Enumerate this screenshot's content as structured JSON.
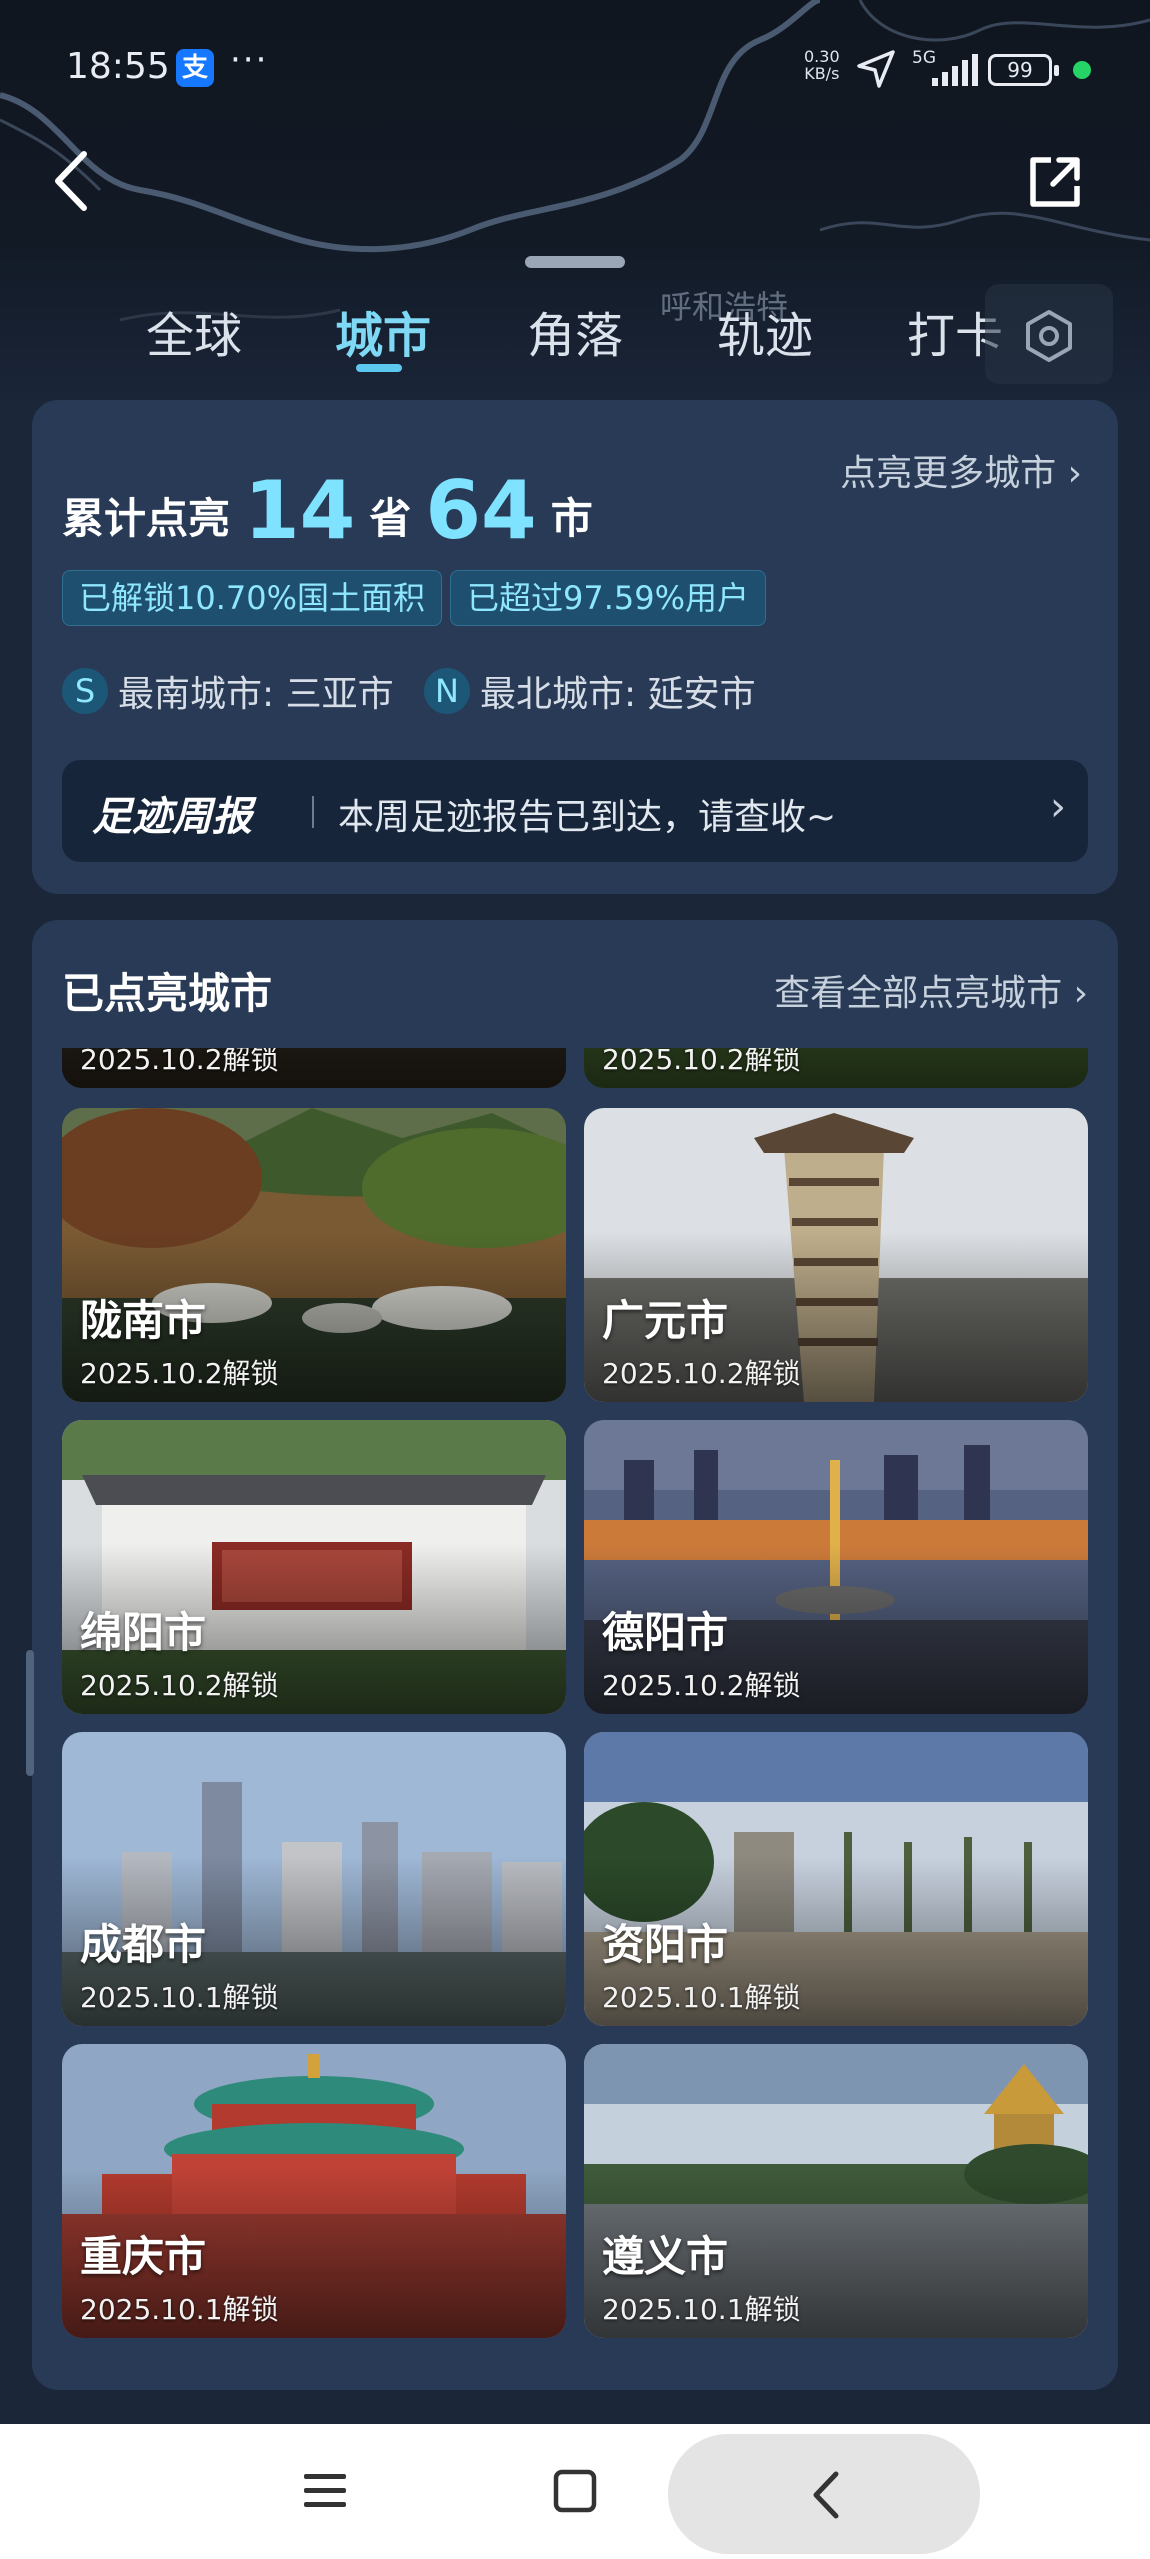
{
  "status_bar": {
    "time": "18:55",
    "app_icon": "支",
    "more": "···",
    "net_speed_value": "0.30",
    "net_speed_unit": "KB/s",
    "network": "5G",
    "battery": "99"
  },
  "map": {
    "city_label": "呼和浩特"
  },
  "tabs": [
    {
      "label": "全球"
    },
    {
      "label": "城市"
    },
    {
      "label": "角落"
    },
    {
      "label": "轨迹"
    },
    {
      "label": "打卡"
    }
  ],
  "summary": {
    "more_link": "点亮更多城市",
    "lit_label": "累计点亮",
    "province_count": "14",
    "province_unit": "省",
    "city_count": "64",
    "city_unit": "市",
    "chip_area": "已解锁10.70%国土面积",
    "chip_users": "已超过97.59%用户",
    "south_badge": "S",
    "south_text": "最南城市: 三亚市",
    "north_badge": "N",
    "north_text": "最北城市: 延安市",
    "report_title": "足迹周报",
    "report_text": "本周足迹报告已到达，请查收~"
  },
  "cities": {
    "title": "已点亮城市",
    "more_link": "查看全部点亮城市",
    "partial_dates": [
      "2025.10.2解锁",
      "2025.10.2解锁"
    ],
    "items": [
      {
        "name": "陇南市",
        "date": "2025.10.2解锁"
      },
      {
        "name": "广元市",
        "date": "2025.10.2解锁"
      },
      {
        "name": "绵阳市",
        "date": "2025.10.2解锁"
      },
      {
        "name": "德阳市",
        "date": "2025.10.2解锁"
      },
      {
        "name": "成都市",
        "date": "2025.10.1解锁"
      },
      {
        "name": "资阳市",
        "date": "2025.10.1解锁"
      },
      {
        "name": "重庆市",
        "date": "2025.10.1解锁"
      },
      {
        "name": "遵义市",
        "date": "2025.10.1解锁"
      }
    ]
  },
  "colors": {
    "accent": "#7fe3ff",
    "card_bg": "#283a55",
    "page_bg": "#1b2638"
  }
}
